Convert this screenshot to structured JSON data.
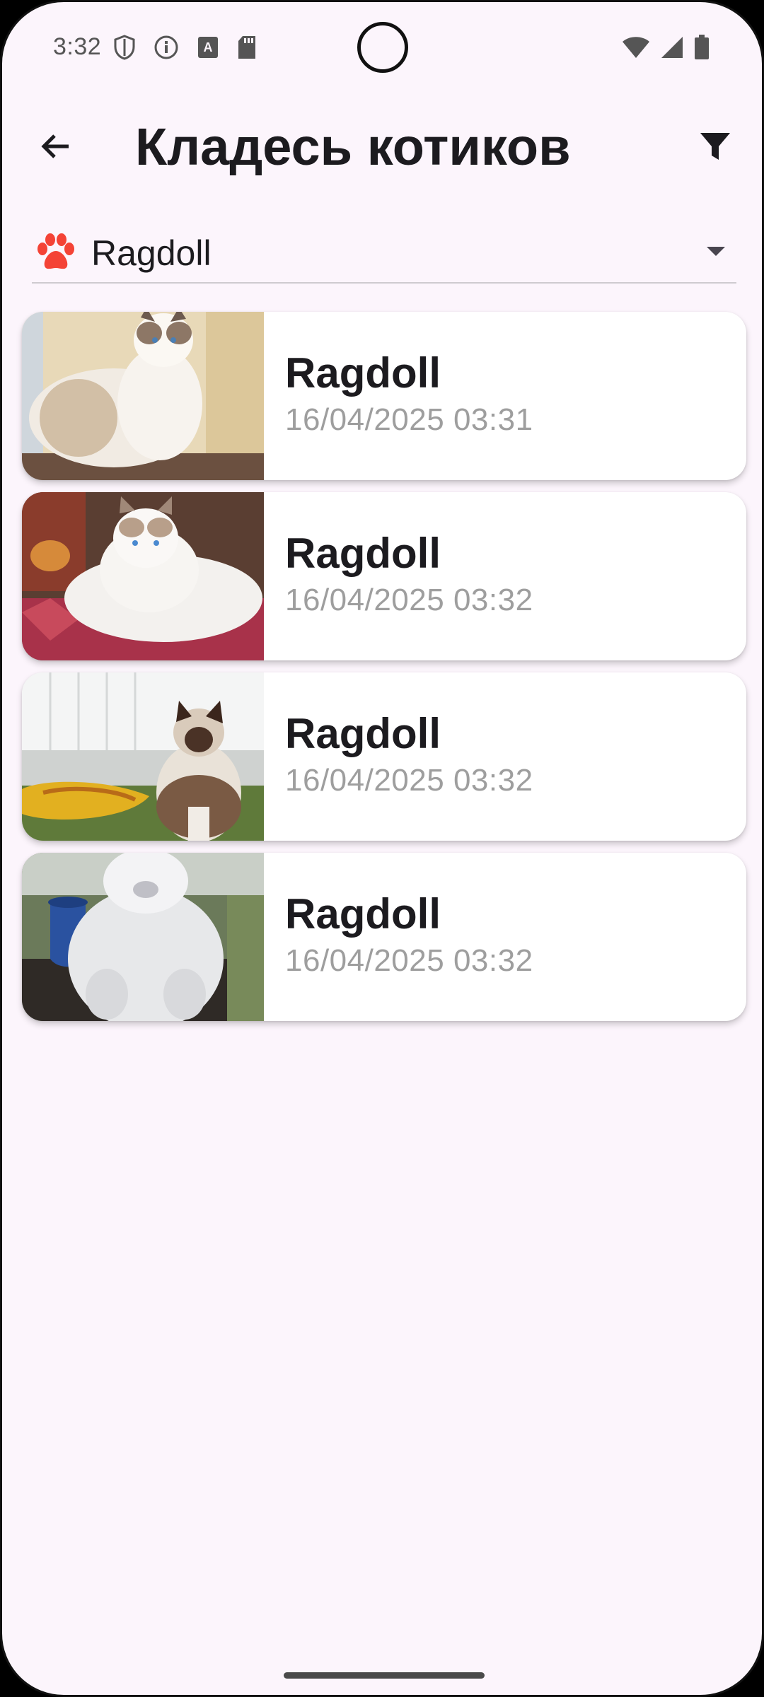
{
  "status_bar": {
    "time": "3:32",
    "left_icons": [
      "shield-icon",
      "info-icon",
      "font-icon",
      "sd-card-icon"
    ],
    "right_icons": [
      "wifi-icon",
      "signal-icon",
      "battery-icon"
    ]
  },
  "app_bar": {
    "title": "Кладесь котиков",
    "back_icon": "arrow-back-icon",
    "filter_icon": "filter-icon"
  },
  "breed_select": {
    "selected": "Ragdoll",
    "icon": "paw-icon",
    "icon_color": "#f44336"
  },
  "cats": [
    {
      "name": "Ragdoll",
      "date": "16/04/2025 03:31",
      "photo": "ragdoll-photo-1"
    },
    {
      "name": "Ragdoll",
      "date": "16/04/2025 03:32",
      "photo": "ragdoll-photo-2"
    },
    {
      "name": "Ragdoll",
      "date": "16/04/2025 03:32",
      "photo": "ragdoll-photo-3"
    },
    {
      "name": "Ragdoll",
      "date": "16/04/2025 03:32",
      "photo": "ragdoll-photo-4"
    }
  ],
  "colors": {
    "background": "#fcf5fc",
    "card": "#ffffff",
    "title_text": "#1c1b1f",
    "date_text": "#9e9e9e"
  }
}
